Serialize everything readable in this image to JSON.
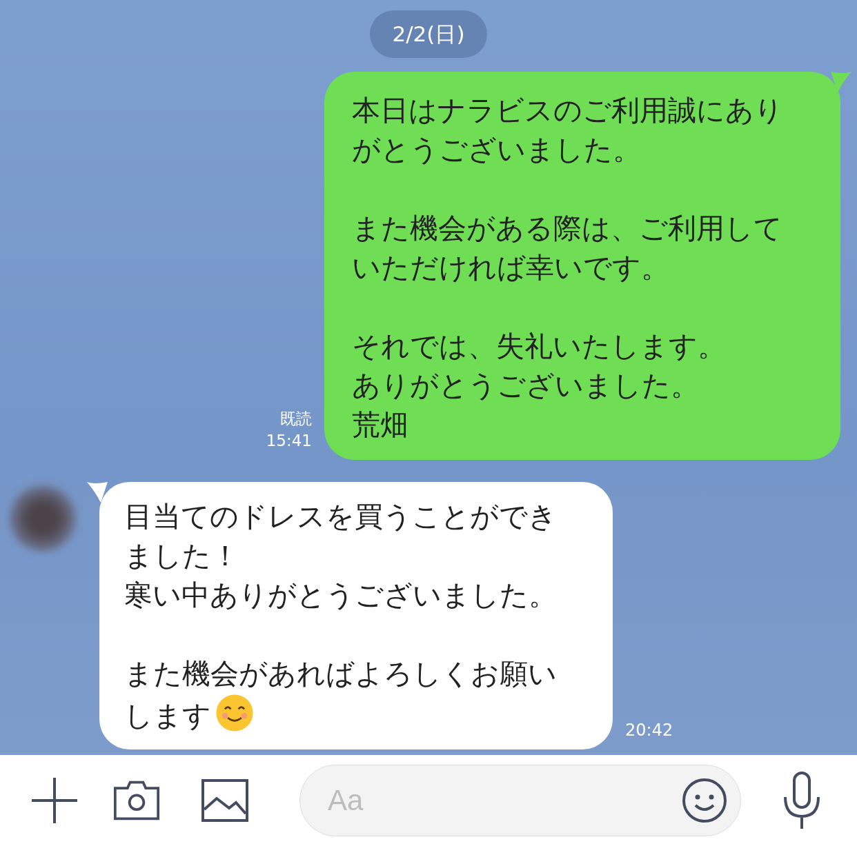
{
  "date_label": "2/2(日)",
  "messages": [
    {
      "kind": "sent",
      "paragraphs": [
        [
          "本日はナラビスのご利用誠にありがとうございました。"
        ],
        [
          "また機会がある際は、ご利用していただければ幸いです。"
        ],
        [
          "それでは、失礼いたします。",
          "ありがとうございました。",
          "荒畑"
        ]
      ],
      "read_label": "既読",
      "time": "15:41"
    },
    {
      "kind": "received",
      "paragraphs": [
        [
          "目当てのドレスを買うことができました！",
          "寒い中ありがとうございました。"
        ],
        [
          "また機会があればよろしくお願いします"
        ]
      ],
      "ends_with_emoji": true,
      "time": "20:42"
    }
  ],
  "composer": {
    "placeholder": "Aa"
  }
}
